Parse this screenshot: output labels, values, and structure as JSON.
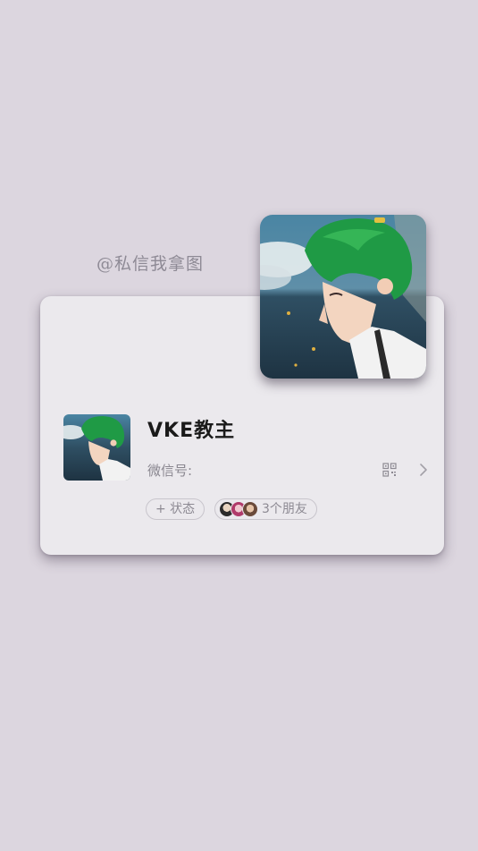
{
  "watermark": "@私信我拿图",
  "profile": {
    "name": "VKE教主",
    "wechat_id_label": "微信号:",
    "status_label": "+ 状态",
    "friends_label": "3个朋友"
  },
  "icons": {
    "qr": "qr-code-icon",
    "chevron": "chevron-right-icon"
  },
  "colors": {
    "background": "#dcd6df",
    "card": "#ebe9ed",
    "avatar_hair": "#1f9a45",
    "avatar_sky": "#3d6f8c"
  }
}
